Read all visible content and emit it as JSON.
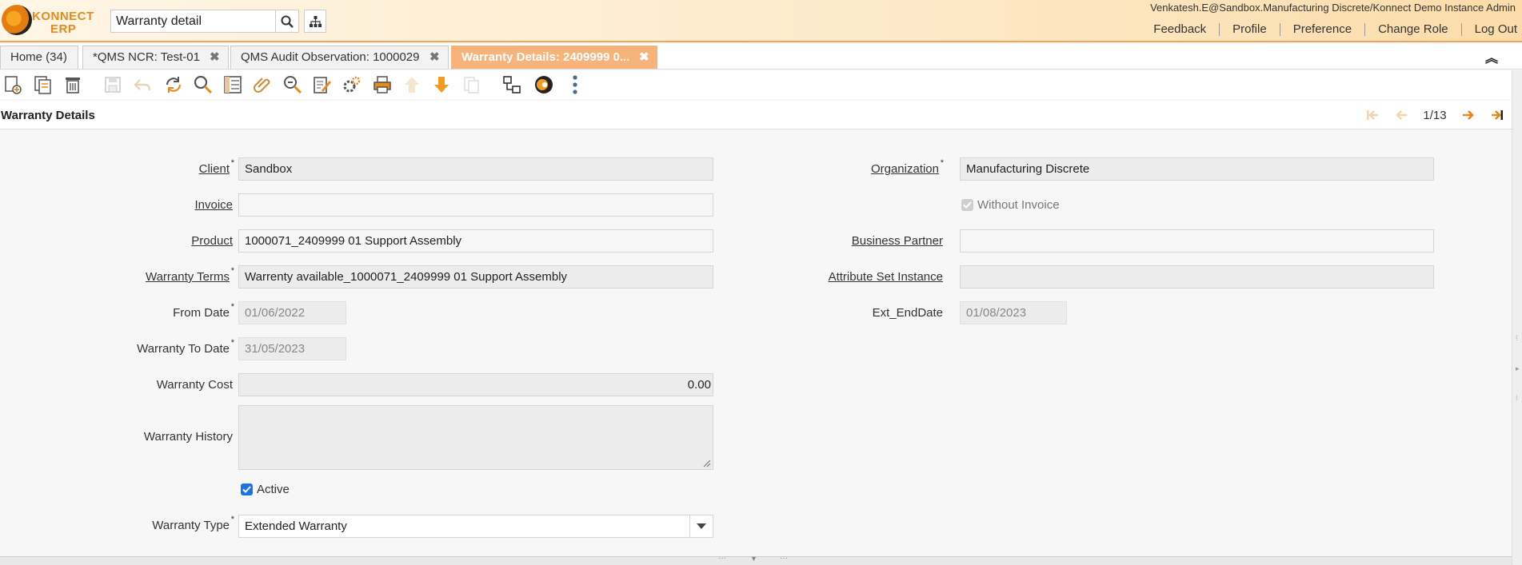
{
  "header": {
    "logo_line1": "KONNECT",
    "logo_line2": "ERP",
    "search_value": "Warranty detail",
    "user": "Venkatesh.E@Sandbox.Manufacturing Discrete/Konnect Demo Instance Admin",
    "links": [
      "Feedback",
      "Profile",
      "Preference",
      "Change Role",
      "Log Out"
    ]
  },
  "tabs": [
    {
      "label": "Home (34)",
      "closable": false
    },
    {
      "label": "*QMS NCR: Test-01",
      "closable": true
    },
    {
      "label": "QMS Audit Observation: 1000029",
      "closable": true
    },
    {
      "label": "Warranty Details: 2409999 0...",
      "closable": true,
      "active": true
    }
  ],
  "toolbar": {
    "icons": [
      "new-record-icon",
      "copy-record-icon",
      "delete-icon",
      "save-icon",
      "undo-icon",
      "refresh-icon",
      "find-icon",
      "grid-toggle-icon",
      "attachment-icon",
      "zoom-across-icon",
      "note-icon",
      "process-icon",
      "print-icon",
      "parent-record-icon",
      "detail-record-icon",
      "archive-icon",
      "related-records-icon",
      "workflow-icon",
      "more-icon"
    ]
  },
  "window": {
    "title": "Warranty Details",
    "record_position": "1/13"
  },
  "form": {
    "client": {
      "label": "Client",
      "value": "Sandbox"
    },
    "organization": {
      "label": "Organization",
      "value": "Manufacturing Discrete"
    },
    "invoice": {
      "label": "Invoice",
      "value": ""
    },
    "without_invoice": {
      "label": "Without Invoice",
      "checked": true
    },
    "product": {
      "label": "Product",
      "value": "1000071_2409999 01 Support Assembly"
    },
    "business_partner": {
      "label": "Business Partner",
      "value": ""
    },
    "warranty_terms": {
      "label": "Warranty Terms",
      "value": "Warrenty available_1000071_2409999 01 Support Assembly"
    },
    "attribute_set_instance": {
      "label": "Attribute Set Instance",
      "value": ""
    },
    "from_date": {
      "label": "From Date",
      "value": "01/06/2022"
    },
    "ext_end_date": {
      "label": "Ext_EndDate",
      "value": "01/08/2023"
    },
    "warranty_to_date": {
      "label": "Warranty To Date",
      "value": "31/05/2023"
    },
    "warranty_cost": {
      "label": "Warranty Cost",
      "value": "0.00"
    },
    "warranty_history": {
      "label": "Warranty History",
      "value": ""
    },
    "active": {
      "label": "Active",
      "checked": true
    },
    "warranty_type": {
      "label": "Warranty Type",
      "value": "Extended Warranty"
    }
  },
  "colors": {
    "accent": "#f7b37a",
    "header_border": "#f0a55a",
    "checkbox": "#1a73e8",
    "nav_arrow": "#e8891a"
  }
}
